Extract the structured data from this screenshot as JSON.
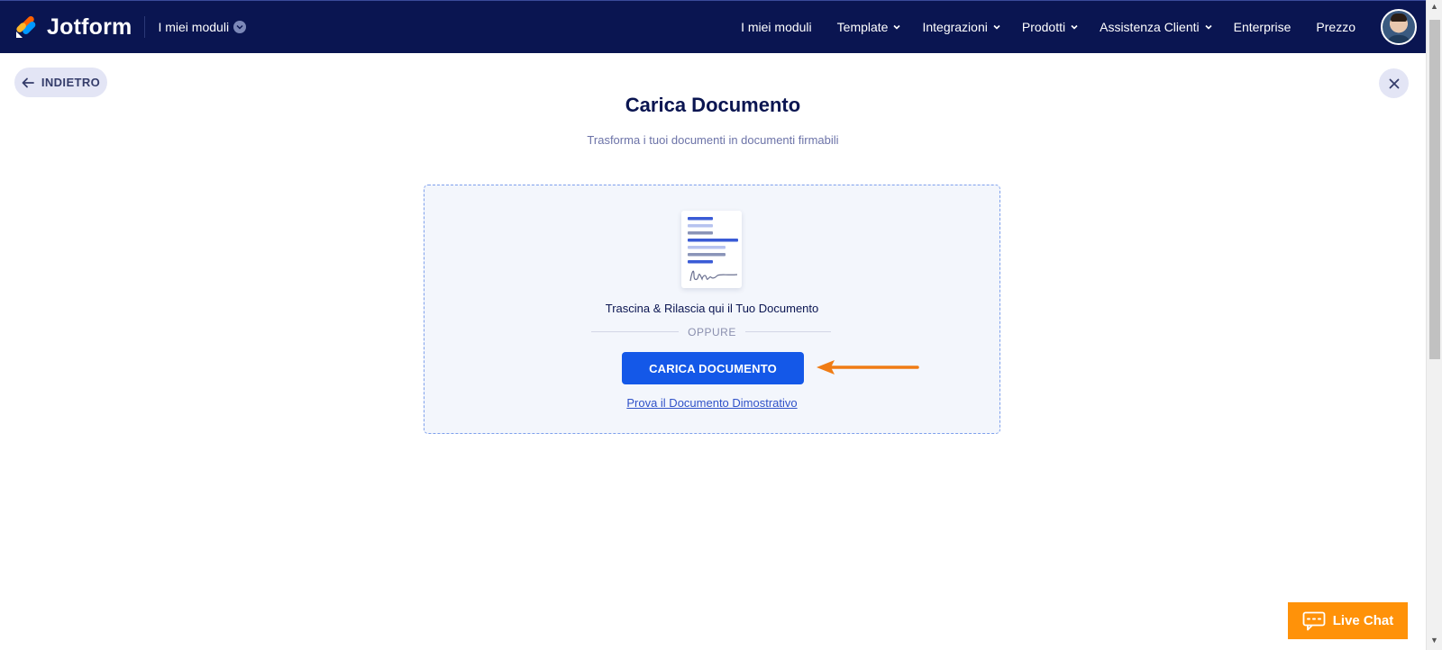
{
  "header": {
    "brand": "Jotform",
    "my_forms": "I miei moduli",
    "nav": [
      {
        "label": "I miei moduli",
        "has_dropdown": false
      },
      {
        "label": "Template",
        "has_dropdown": true
      },
      {
        "label": "Integrazioni",
        "has_dropdown": true
      },
      {
        "label": "Prodotti",
        "has_dropdown": true
      },
      {
        "label": "Assistenza Clienti",
        "has_dropdown": true
      },
      {
        "label": "Enterprise",
        "has_dropdown": false
      },
      {
        "label": "Prezzo",
        "has_dropdown": false
      }
    ]
  },
  "back_label": "INDIETRO",
  "title": "Carica Documento",
  "subtitle": "Trasforma i tuoi documenti in documenti firmabili",
  "dropzone": {
    "drag_text": "Trascina & Rilascia qui il Tuo Documento",
    "or_text": "OPPURE",
    "upload_label": "CARICA DOCUMENTO",
    "demo_link": "Prova il Documento Dimostrativo"
  },
  "livechat": "Live Chat",
  "colors": {
    "nav_bg": "#0a1551",
    "primary": "#1458e8",
    "accent_orange": "#ff9209",
    "dropzone_bg": "#f3f6fc"
  }
}
